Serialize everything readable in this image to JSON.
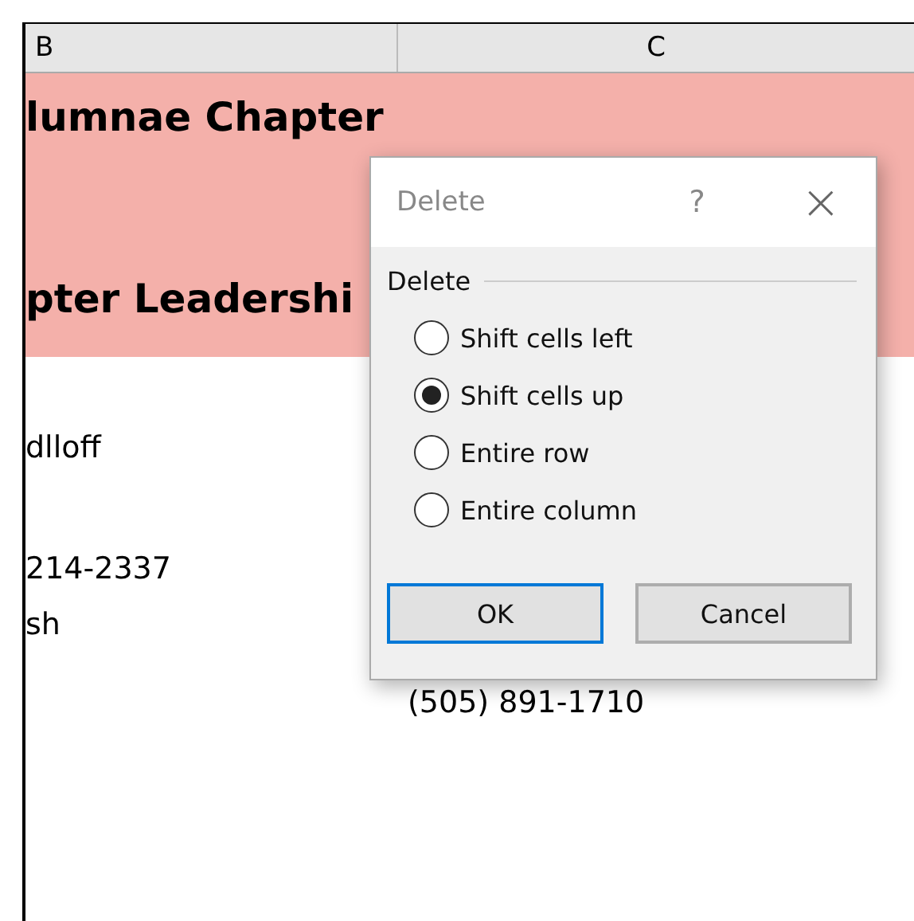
{
  "sheet": {
    "columns": [
      {
        "label": "B"
      },
      {
        "label": "C"
      }
    ],
    "rows": [
      {
        "kind": "banner",
        "cells": [
          "lumnae Chapter",
          ""
        ]
      },
      {
        "kind": "banner",
        "cells": [
          "pter Leadershi",
          ""
        ]
      },
      {
        "kind": "plain",
        "cells": [
          "dlloff",
          ""
        ]
      },
      {
        "kind": "plain",
        "cells": [
          "214-2337",
          ""
        ]
      },
      {
        "kind": "plain",
        "cells": [
          "sh",
          ""
        ]
      },
      {
        "kind": "plain",
        "cells": [
          "",
          "(505) 891-1710"
        ]
      }
    ]
  },
  "dialog": {
    "title": "Delete",
    "help": "?",
    "close": "×",
    "group": "Delete",
    "options": [
      {
        "label": "Shift cells left",
        "selected": false
      },
      {
        "label": "Shift cells up",
        "selected": true
      },
      {
        "label": "Entire row",
        "selected": false
      },
      {
        "label": "Entire column",
        "selected": false
      }
    ],
    "buttons": [
      {
        "label": "OK",
        "default": true
      },
      {
        "label": "Cancel",
        "default": false
      }
    ]
  }
}
